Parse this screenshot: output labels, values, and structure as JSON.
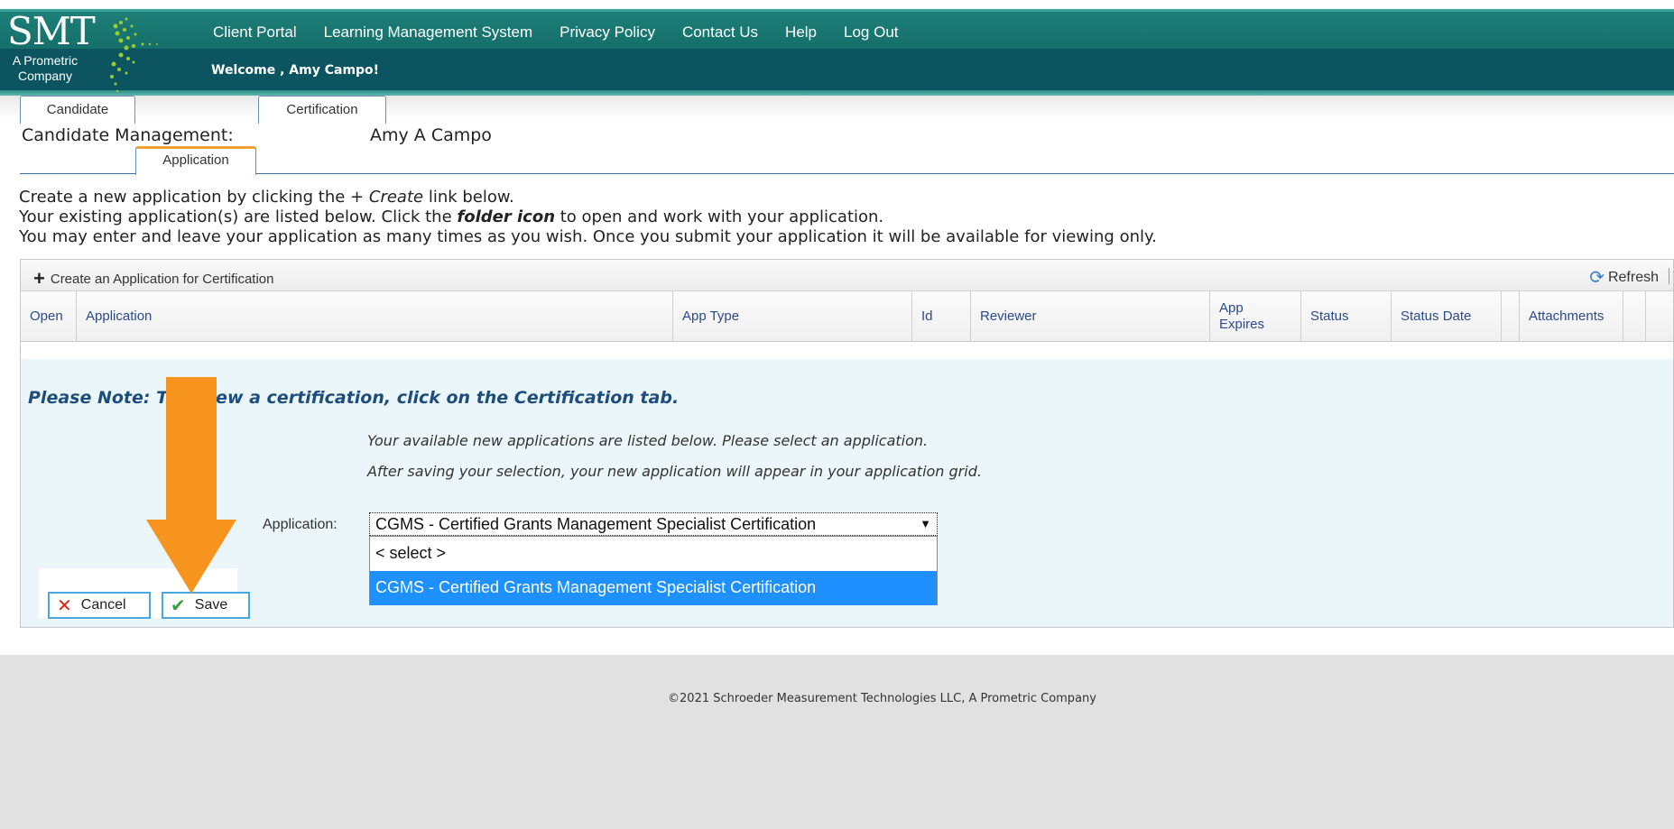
{
  "header": {
    "logo_text": "SMT",
    "logo_sub_line1": "A Prometric",
    "logo_sub_line2": "Company",
    "nav": [
      "Client Portal",
      "Learning Management System",
      "Privacy Policy",
      "Contact Us",
      "Help",
      "Log Out"
    ],
    "welcome": "Welcome , Amy Campo!"
  },
  "page": {
    "title": "Candidate Management:",
    "candidate_name": "Amy A Campo",
    "tabs": [
      "Candidate",
      "Application",
      "Certification"
    ],
    "active_tab": "Application"
  },
  "intro": {
    "line1_pre": "Create a new application by clicking the + ",
    "line1_em": "Create",
    "line1_post": " link below.",
    "line2_pre": "Your existing application(s) are listed below. Click the ",
    "line2_em": "folder icon",
    "line2_post": " to open and work with your application.",
    "line3": "You may enter and leave your application as many times as you wish. Once you submit your application it will be available for viewing only."
  },
  "grid": {
    "create_label": "Create an Application for Certification",
    "refresh_label": "Refresh",
    "columns": [
      "Open",
      "Application",
      "App Type",
      "Id",
      "Reviewer",
      "App Expires",
      "Status",
      "Status Date",
      "Attachments"
    ]
  },
  "form": {
    "note": "Please Note: To renew a certification, click on the Certification tab.",
    "available_line1": "Your available new applications are listed below. Please select an application.",
    "available_line2": "After saving your selection, your new application will appear in your application grid.",
    "application_label": "Application:",
    "selected_value": "CGMS - Certified Grants Management Specialist Certification",
    "options": [
      "< select >",
      "CGMS - Certified Grants Management Specialist Certification"
    ],
    "cancel_label": "Cancel",
    "save_label": "Save"
  },
  "footer": {
    "copyright": "©2021 Schroeder Measurement Technologies LLC, A Prometric Company"
  },
  "colors": {
    "header_teal": "#16706c",
    "accent_orange": "#f7941d",
    "selected_option": "#1e90ff",
    "note_text": "#1e4d7b"
  }
}
